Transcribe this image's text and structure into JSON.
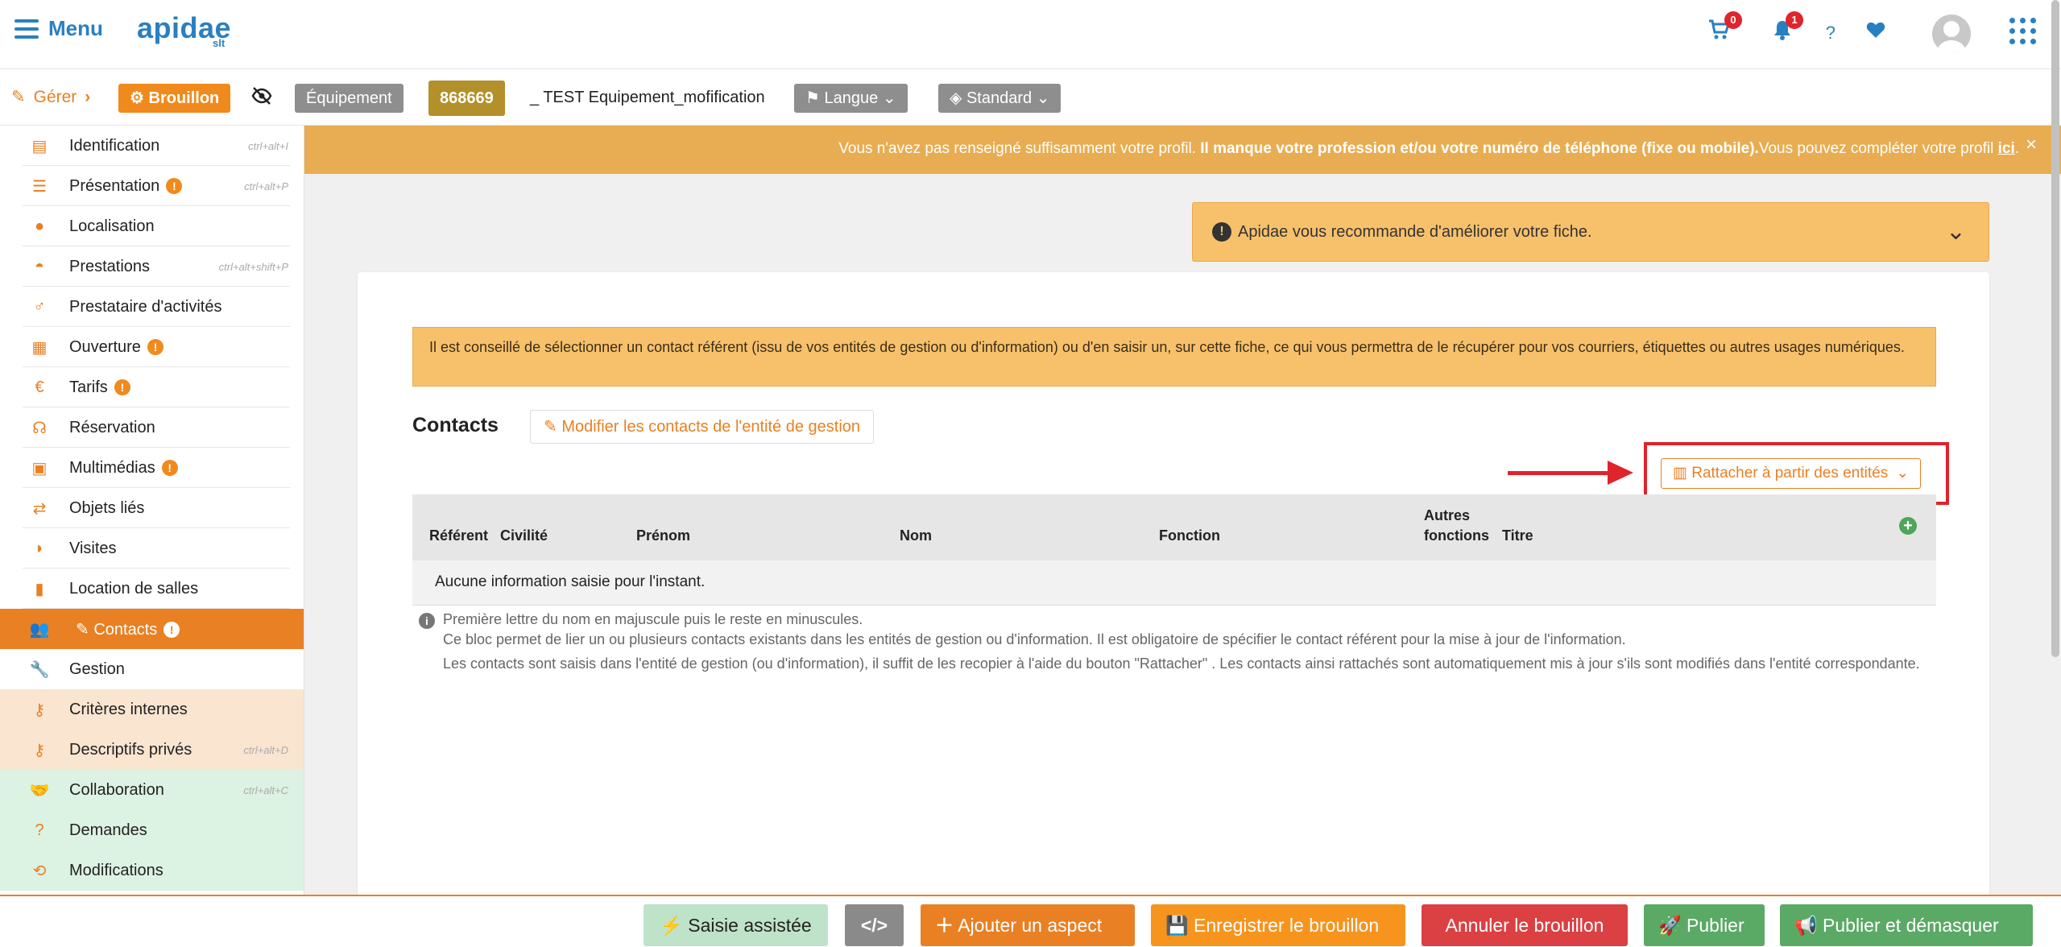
{
  "header": {
    "menu_label": "Menu",
    "logo_text": "apidae",
    "logo_sub": "slt",
    "cart_count": "0",
    "notif_count": "1",
    "help_label": "?"
  },
  "subbar": {
    "manage_label": "Gérer",
    "status_label": "Brouillon",
    "type_label": "Équipement",
    "record_id": "868669",
    "record_title": "_ TEST Equipement_mofification",
    "language_label": "Langue",
    "standard_label": "Standard"
  },
  "sidebar": {
    "items": [
      {
        "label": "Identification",
        "shortcut": "ctrl+alt+I",
        "icon": "id-card-icon"
      },
      {
        "label": "Présentation",
        "shortcut": "ctrl+alt+P",
        "icon": "list-icon",
        "warning": "!"
      },
      {
        "label": "Localisation",
        "shortcut": "",
        "icon": "map-pin-icon"
      },
      {
        "label": "Prestations",
        "shortcut": "ctrl+alt+shift+P",
        "icon": "service-bell-icon"
      },
      {
        "label": "Prestataire d'activités",
        "shortcut": "",
        "icon": "person-walking-icon"
      },
      {
        "label": "Ouverture",
        "shortcut": "",
        "icon": "calendar-icon",
        "warning": "!"
      },
      {
        "label": "Tarifs",
        "shortcut": "",
        "icon": "euro-icon",
        "warning": "!"
      },
      {
        "label": "Réservation",
        "shortcut": "",
        "icon": "headset-icon"
      },
      {
        "label": "Multimédias",
        "shortcut": "",
        "icon": "images-icon",
        "warning": "!"
      },
      {
        "label": "Objets liés",
        "shortcut": "",
        "icon": "arrows-exchange-icon"
      },
      {
        "label": "Visites",
        "shortcut": "",
        "icon": "visits-icon"
      },
      {
        "label": "Location de salles",
        "shortcut": "",
        "icon": "bookmark-icon"
      },
      {
        "label": "Contacts",
        "shortcut": "",
        "icon": "users-icon",
        "warning": "!"
      },
      {
        "label": "Gestion",
        "shortcut": "",
        "icon": "wrench-icon"
      },
      {
        "label": "Critères internes",
        "shortcut": "",
        "icon": "key-icon"
      },
      {
        "label": "Descriptifs privés",
        "shortcut": "ctrl+alt+D",
        "icon": "key-icon"
      },
      {
        "label": "Collaboration",
        "shortcut": "ctrl+alt+C",
        "icon": "handshake-icon"
      },
      {
        "label": "Demandes",
        "shortcut": "",
        "icon": "question-circle-icon"
      },
      {
        "label": "Modifications",
        "shortcut": "",
        "icon": "sync-icon"
      }
    ]
  },
  "notice": {
    "text_start": "Vous n'avez pas renseigné suffisamment votre profil. ",
    "text_bold": "Il manque votre profession et/ou votre numéro de téléphone (fixe ou mobile).",
    "text_end": "Vous pouvez compléter votre profil ",
    "link": "ici",
    "period": ".",
    "close": "×"
  },
  "recommend": {
    "text": "Apidae vous recommande d'améliorer votre fiche."
  },
  "main": {
    "advice": "Il est conseillé de sélectionner un contact référent (issu de vos entités de gestion ou d'information) ou d'en saisir un, sur cette fiche, ce qui vous permettra de le récupérer pour vos courriers, étiquettes ou autres usages numériques.",
    "contacts_title": "Contacts",
    "modify_button": "Modifier les contacts de l'entité de gestion",
    "attach_button": "Rattacher à partir des entités",
    "table": {
      "headers": [
        "Référent",
        "Civilité",
        "Prénom",
        "Nom",
        "Fonction",
        "Autres",
        "fonctions",
        "Titre"
      ],
      "empty": "Aucune information saisie pour l'instant."
    },
    "help": [
      "Première lettre du nom en majuscule puis le reste en minuscules.",
      "Ce bloc permet de lier un ou plusieurs contacts existants dans les entités de gestion ou d'information. Il est obligatoire de spécifier le contact référent pour la mise à jour de l'information.",
      "Les contacts sont saisis dans l'entité de gestion (ou d'information), il suffit de les recopier à l'aide du bouton \"Rattacher\" . Les contacts ainsi rattachés sont automatiquement mis à jour s'ils sont modifiés dans l'entité correspondante."
    ]
  },
  "bottombar": {
    "assist": "Saisie assistée",
    "code": "</>",
    "add_aspect": "Ajouter un aspect",
    "save_draft": "Enregistrer le brouillon",
    "cancel_draft": "Annuler le brouillon",
    "publish": "Publier",
    "publish_unmask": "Publier et démasquer"
  },
  "colors": {
    "accent_orange": "#e98023",
    "brand_blue": "#2a7fc1",
    "notice_bg": "#e8ad52",
    "highlight_red": "#e0242b",
    "publish_green": "#5aa964"
  }
}
